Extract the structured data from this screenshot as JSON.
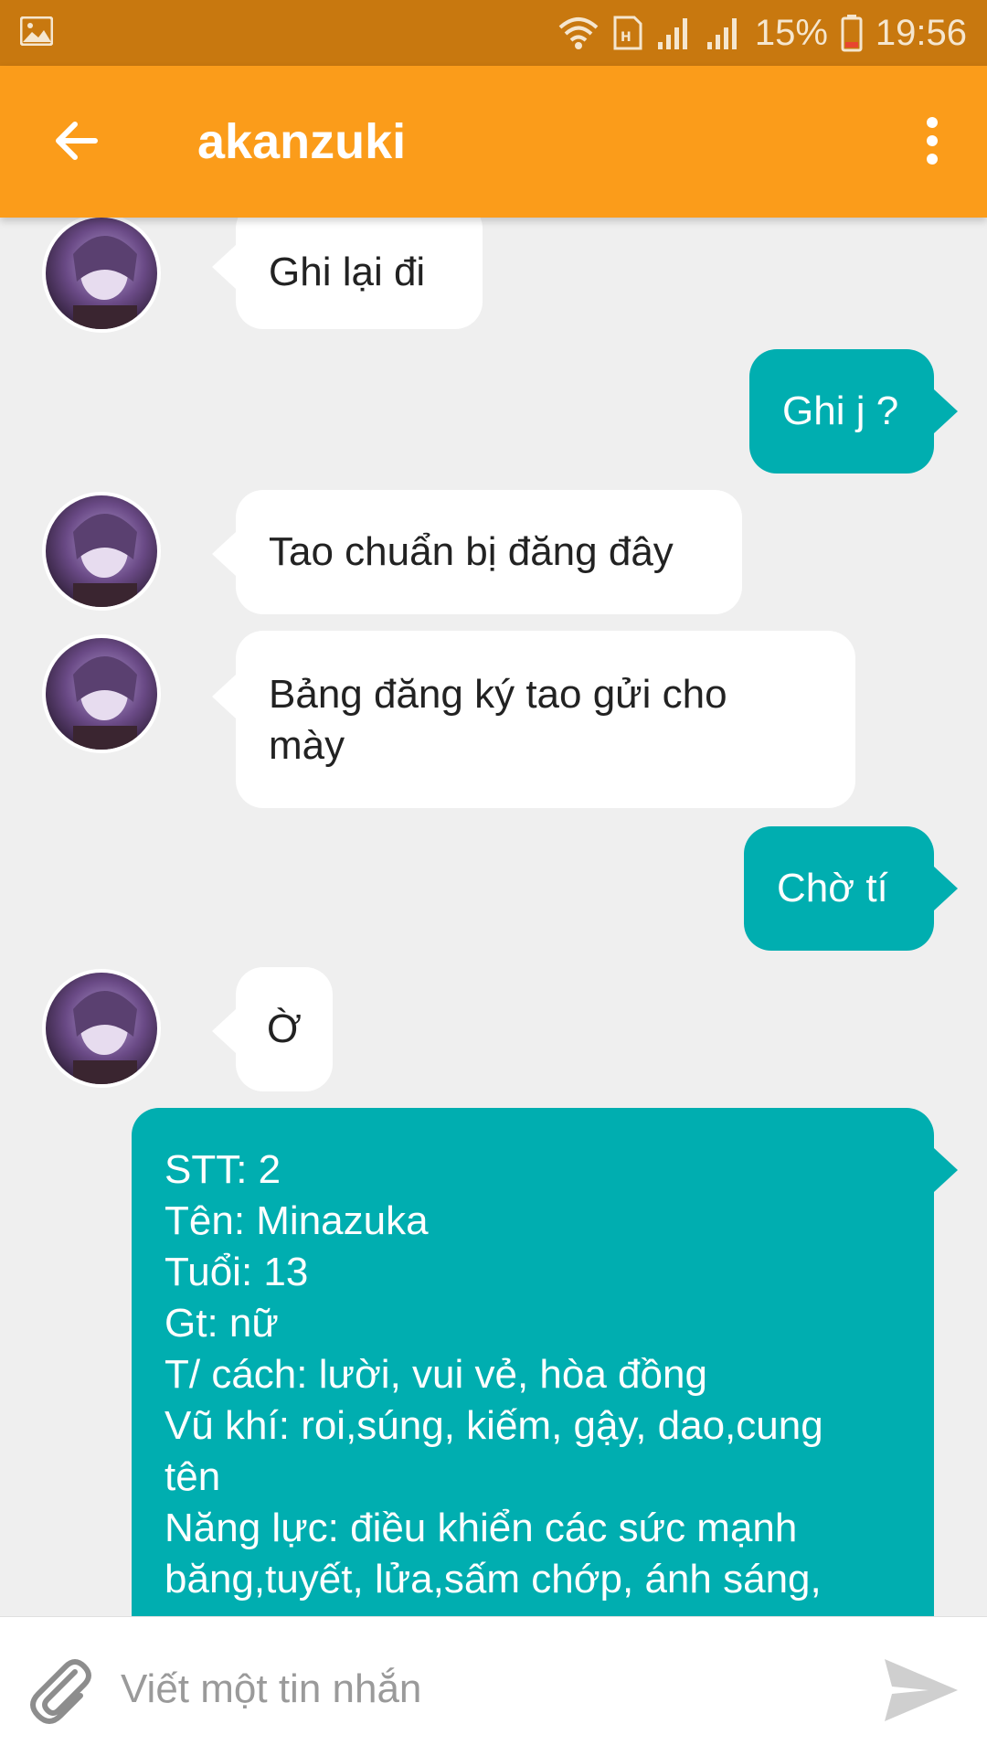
{
  "status_bar": {
    "battery": "15%",
    "time": "19:56",
    "icons": [
      "image-icon",
      "wifi-icon",
      "sim-icon",
      "signal-icon",
      "signal-icon",
      "battery-icon"
    ]
  },
  "header": {
    "title": "akanzuki",
    "back_icon": "arrow-left-icon",
    "menu_icon": "more-vertical-icon"
  },
  "messages": [
    {
      "side": "incoming",
      "text": "Ghi lại đi"
    },
    {
      "side": "outgoing",
      "text": "Ghi j ?"
    },
    {
      "side": "incoming",
      "text": "Tao chuẩn bị đăng đây"
    },
    {
      "side": "incoming",
      "text": "Bảng đăng ký tao gửi cho\nmày"
    },
    {
      "side": "outgoing",
      "text": "Chờ tí"
    },
    {
      "side": "incoming",
      "text": "Ờ"
    },
    {
      "side": "outgoing",
      "text": "STT: 2\nTên: Minazuka\nTuổi: 13\nGt: nữ\nT/ cách: lười, vui vẻ, hòa đồng\nVũ khí: roi,súng, kiếm, gậy, dao,cung\ntên\nNăng lực: điều khiển các sức mạnh\nbăng,tuyết, lửa,sấm chớp, ánh sáng,"
    }
  ],
  "composer": {
    "placeholder": "Viết một tin nhắn",
    "attach_icon": "paperclip-icon",
    "send_icon": "send-icon"
  },
  "colors": {
    "status_bar": "#c8780f",
    "app_bar": "#fb9c1a",
    "outgoing_bubble": "#00aeb0",
    "incoming_bubble": "#ffffff",
    "background": "#efefef"
  }
}
